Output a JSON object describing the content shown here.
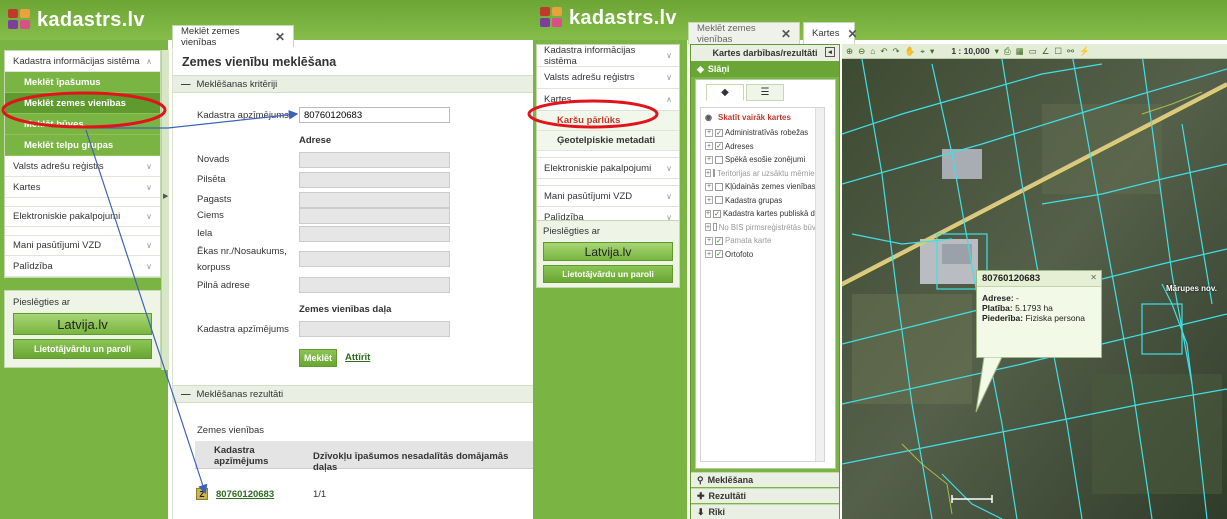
{
  "brand": {
    "name": "kadastrs.lv"
  },
  "left": {
    "sidebar": {
      "sections": [
        {
          "label": "Kadastra informācijas sistēma",
          "subitems": [
            "Meklēt īpašumus",
            "Meklēt zemes vienības",
            "Meklēt būves",
            "Meklēt telpu grupas"
          ]
        },
        {
          "label": "Valsts adrešu reģistrs"
        },
        {
          "label": "Kartes"
        },
        {
          "label": "Elektroniskie pakalpojumi"
        },
        {
          "label": "Mani pasūtījumi VZD"
        },
        {
          "label": "Palīdzība"
        }
      ],
      "connect_label": "Pieslēgties ar",
      "latvija_button": "Latvija.lv",
      "login_button": "Lietotājvārdu un paroli"
    },
    "tab_label": "Meklēt zemes vienības",
    "panel_title": "Zemes vienību meklēšana",
    "criteria_header": "Meklēšanas kritēriji",
    "form": {
      "cadastre_label": "Kadastra apzīmējums",
      "cadastre_value": "80760120683",
      "address_heading": "Adrese",
      "fields": [
        "Novads",
        "Pilsēta",
        "Pagasts",
        "Ciems",
        "Iela",
        "Ēkas nr./Nosaukums,",
        "korpuss",
        "Pilnā adrese"
      ],
      "part_heading": "Zemes vienības daļa",
      "part_label": "Kadastra apzīmējums",
      "search_button": "Meklēt",
      "reset_link": "Attīrīt"
    },
    "results": {
      "header": "Meklēšanas rezultāti",
      "subheading": "Zemes vienības",
      "col1": "Kadastra apzīmējums",
      "col2": "Dzīvokļu īpašumos nesadalītās domājamās daļas",
      "row_icon": "Z",
      "row_id": "80760120683",
      "row_share": "1/1"
    }
  },
  "right": {
    "sidebar": {
      "items": [
        "Kadastra informācijas sistēma",
        "Valsts adrešu reģistrs",
        "Kartes",
        "Elektroniskie pakalpojumi",
        "Mani pasūtījumi VZD",
        "Palīdzība"
      ],
      "kartes_sub": [
        "Karšu pārlūks",
        "Ģeotelpiskie metadati"
      ],
      "connect_label": "Pieslēgties ar",
      "latvija_button": "Latvija.lv",
      "login_button": "Lietotājvārdu un paroli"
    },
    "tabs": [
      "Meklēt zemes vienības",
      "Kartes"
    ],
    "layers_panel": {
      "header": "Kartes darbības/rezultāti",
      "subheader": "Slāņi",
      "more_maps": "Skatīt vairāk kartes",
      "layers": [
        {
          "label": "Administratīvās robežas",
          "checked": true,
          "dim": false
        },
        {
          "label": "Adreses",
          "checked": true,
          "dim": false
        },
        {
          "label": "Spēkā esošie zonējumi",
          "checked": false,
          "dim": false
        },
        {
          "label": "Teritorijas ar uzsāktu mērniecību",
          "checked": false,
          "dim": true
        },
        {
          "label": "Kļūdainās zemes vienības",
          "checked": false,
          "dim": false
        },
        {
          "label": "Kadastra grupas",
          "checked": false,
          "dim": false
        },
        {
          "label": "Kadastra kartes publiskā daļa",
          "checked": true,
          "dim": false
        },
        {
          "label": "No BIS pirmsreģistrētās būves",
          "checked": false,
          "dim": true
        },
        {
          "label": "Pamata karte",
          "checked": true,
          "dim": true
        },
        {
          "label": "Ortofoto",
          "checked": true,
          "dim": false
        }
      ],
      "footer": [
        "Meklēšana",
        "Rezultāti",
        "Rīki"
      ]
    },
    "map": {
      "scale": "1 : 10,000",
      "popup": {
        "title": "80760120683",
        "address_label": "Adrese:",
        "address_value": "-",
        "area_label": "Platība:",
        "area_value": "5.1793 ha",
        "ownership_label": "Piederība:",
        "ownership_value": "Fiziska persona"
      },
      "place_label": "Mārupes nov."
    }
  }
}
